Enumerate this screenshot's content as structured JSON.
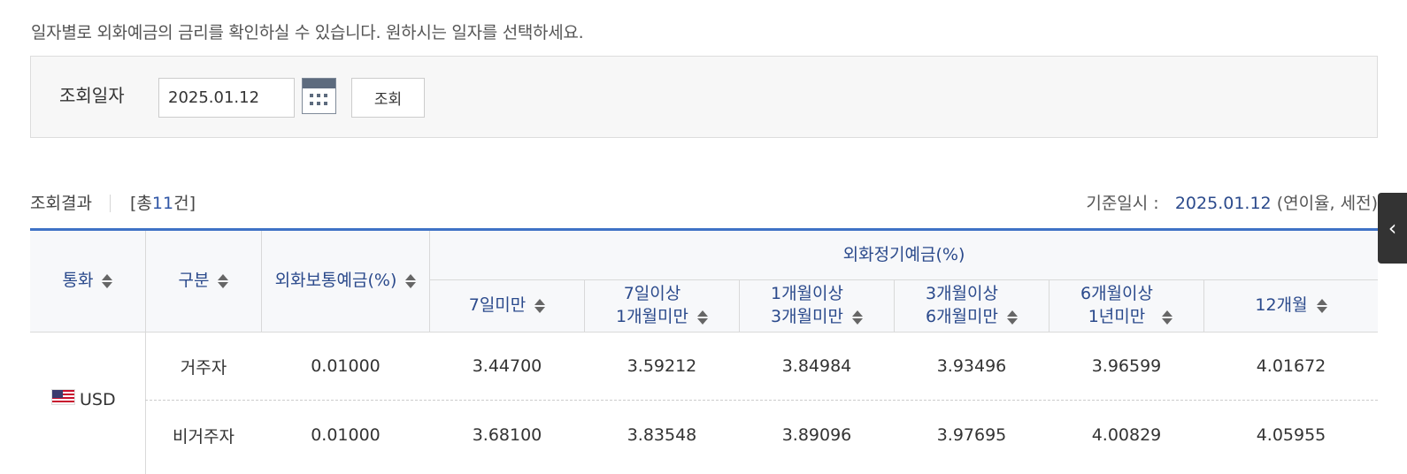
{
  "intro_text": "일자별로 외화예금의 금리를 확인하실 수 있습니다. 원하시는 일자를 선택하세요.",
  "search": {
    "label": "조회일자",
    "date_value": "2025.01.12",
    "button_label": "조회",
    "calendar_icon": "calendar-icon"
  },
  "result": {
    "title": "조회결과",
    "count_prefix": "[총",
    "count": "11",
    "count_suffix": "건]",
    "base_label": "기준일시 :",
    "base_date": "2025.01.12",
    "base_note": "(연이율, 세전)"
  },
  "side_tab": {
    "icon": "chevron-left-icon",
    "glyph": "‹"
  },
  "table": {
    "headers": {
      "currency": "통화",
      "type": "구분",
      "savings": "외화보통예금(%)",
      "term_group": "외화정기예금(%)",
      "terms": [
        {
          "line1": "7일미만",
          "line2": ""
        },
        {
          "line1": "7일이상",
          "line2": "1개월미만"
        },
        {
          "line1": "1개월이상",
          "line2": "3개월미만"
        },
        {
          "line1": "3개월이상",
          "line2": "6개월미만"
        },
        {
          "line1": "6개월이상",
          "line2": "1년미만"
        },
        {
          "line1": "12개월",
          "line2": ""
        }
      ]
    },
    "rows": [
      {
        "currency": "USD",
        "flag_icon": "us-flag-icon",
        "entries": [
          {
            "type": "거주자",
            "savings": "0.01000",
            "terms": [
              "3.44700",
              "3.59212",
              "3.84984",
              "3.93496",
              "3.96599",
              "4.01672"
            ]
          },
          {
            "type": "비거주자",
            "savings": "0.01000",
            "terms": [
              "3.68100",
              "3.83548",
              "3.89096",
              "3.97695",
              "4.00829",
              "4.05955"
            ]
          }
        ]
      }
    ]
  },
  "colors": {
    "accent_blue": "#3f72c6",
    "header_text": "#2b4a8c",
    "side_tab": "#333333"
  }
}
